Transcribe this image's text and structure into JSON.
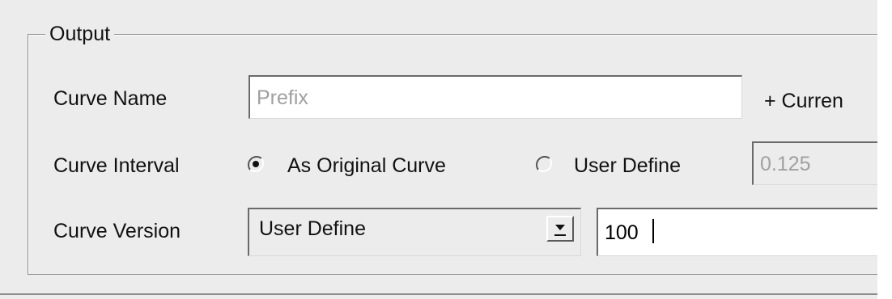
{
  "output_group": {
    "title": "Output",
    "curve_name": {
      "label": "Curve Name",
      "placeholder": "Prefix",
      "value": "",
      "suffix_label": "+ Curren"
    },
    "curve_interval": {
      "label": "Curve Interval",
      "options": [
        {
          "label": "As Original Curve",
          "selected": true
        },
        {
          "label": "User Define",
          "selected": false
        }
      ],
      "value": "0.125"
    },
    "curve_version": {
      "label": "Curve Version",
      "selected": "User Define",
      "value": "100"
    }
  },
  "icons": {
    "radio_selected": "radio-selected-icon",
    "radio_unselected": "radio-unselected-icon",
    "dropdown": "chevron-down-icon"
  },
  "colors": {
    "panel_bg": "#ececec",
    "field_bg": "#ffffff",
    "disabled_text": "#a0a0a0",
    "text": "#111111",
    "border_dark": "#6a6a6a"
  }
}
